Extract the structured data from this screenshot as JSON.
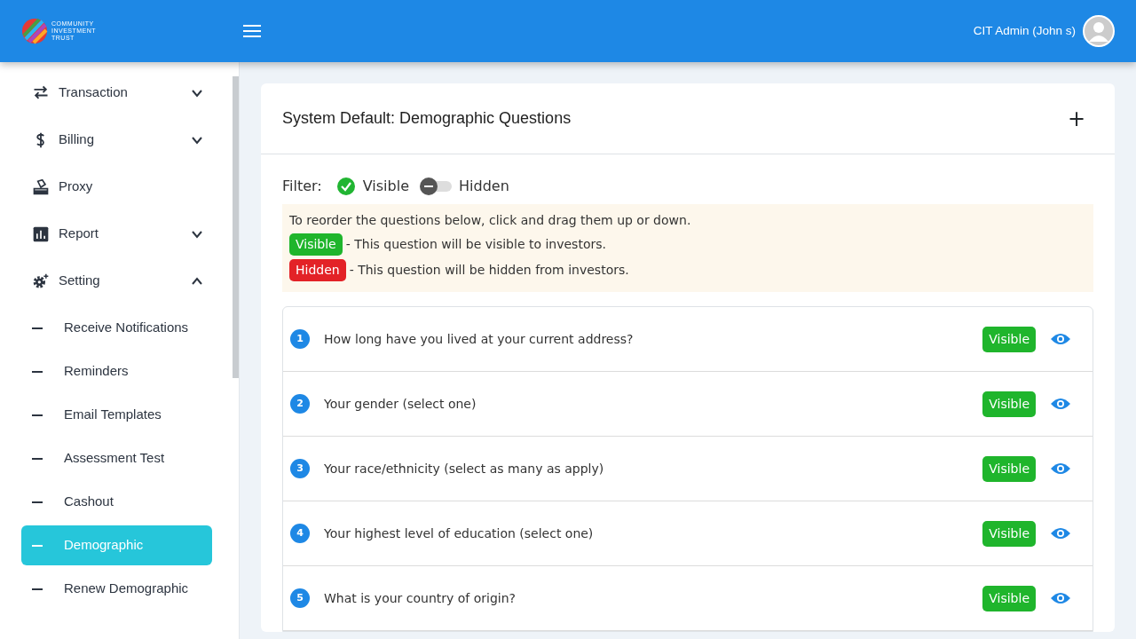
{
  "header": {
    "logo_lines": [
      "COMMUNITY",
      "INVESTMENT",
      "TRUST"
    ],
    "user_name": "CIT Admin (John s)"
  },
  "sidebar": {
    "items": [
      {
        "label": "Transaction",
        "kind": "arrows",
        "expanded": false
      },
      {
        "label": "Billing",
        "kind": "dollar",
        "expanded": false
      },
      {
        "label": "Proxy",
        "kind": "ballot"
      },
      {
        "label": "Report",
        "kind": "chart",
        "expanded": false
      },
      {
        "label": "Setting",
        "kind": "gear",
        "expanded": true,
        "children": [
          {
            "label": "Receive Notifications",
            "selected": false
          },
          {
            "label": "Reminders",
            "selected": false
          },
          {
            "label": "Email Templates",
            "selected": false
          },
          {
            "label": "Assessment Test",
            "selected": false
          },
          {
            "label": "Cashout",
            "selected": false
          },
          {
            "label": "Demographic",
            "selected": true
          },
          {
            "label": "Renew Demographic",
            "selected": false
          }
        ]
      }
    ]
  },
  "card": {
    "title": "System Default: Demographic Questions",
    "add_label": "+",
    "filter": {
      "label": "Filter:",
      "options": [
        {
          "label": "Visible",
          "on": true
        },
        {
          "label": "Hidden",
          "on": false
        }
      ]
    },
    "notice": {
      "text": "To reorder the questions below, click and drag them up or down.",
      "legend": [
        {
          "badge": "Visible",
          "visible": true,
          "text": "- This question will be visible to investors."
        },
        {
          "badge": "Hidden",
          "visible": false,
          "text": "- This question will be hidden from investors."
        }
      ]
    },
    "questions": [
      {
        "number": "1",
        "text": "How long have you lived at your current address?",
        "badge": "Visible",
        "visible": true
      },
      {
        "number": "2",
        "text": "Your gender (select one)",
        "badge": "Visible",
        "visible": true
      },
      {
        "number": "3",
        "text": "Your race/ethnicity (select as many as apply)",
        "badge": "Visible",
        "visible": true
      },
      {
        "number": "4",
        "text": "Your highest level of education (select one)",
        "badge": "Visible",
        "visible": true
      },
      {
        "number": "5",
        "text": "What is your country of origin?",
        "badge": "Visible",
        "visible": true
      }
    ]
  }
}
